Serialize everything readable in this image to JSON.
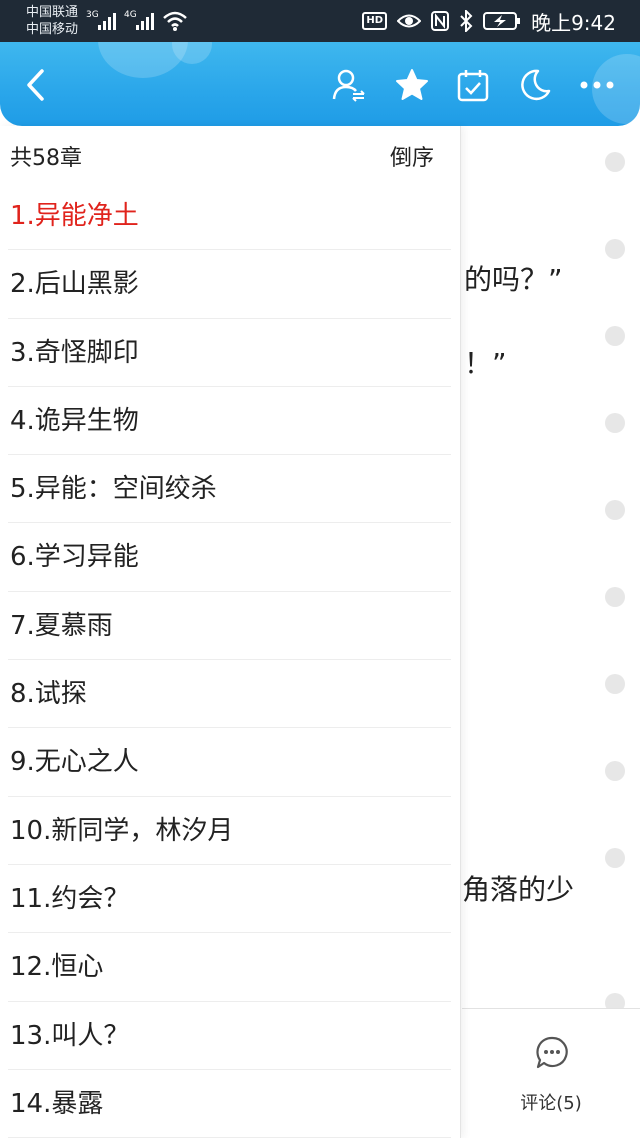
{
  "status_bar": {
    "carrier1": "中国联通",
    "carrier2": "中国移动",
    "net1": "3G",
    "net2": "4G",
    "hd": "HD",
    "time": "晚上9:42"
  },
  "header": {
    "icons": [
      "back-icon",
      "user-switch-icon",
      "star-icon",
      "calendar-check-icon",
      "moon-icon",
      "more-icon"
    ]
  },
  "drawer": {
    "count_label": "共58章",
    "reverse_label": "倒序",
    "active_color": "#e0231c",
    "chapters": [
      {
        "label": "1.异能净土",
        "active": true
      },
      {
        "label": "2.后山黑影"
      },
      {
        "label": "3.奇怪脚印"
      },
      {
        "label": "4.诡异生物"
      },
      {
        "label": "5.异能：空间绞杀"
      },
      {
        "label": "6.学习异能"
      },
      {
        "label": "7.夏慕雨"
      },
      {
        "label": "8.试探"
      },
      {
        "label": "9.无心之人"
      },
      {
        "label": "10.新同学，林汐月"
      },
      {
        "label": "11.约会？"
      },
      {
        "label": "12.恒心"
      },
      {
        "label": "13.叫人？"
      },
      {
        "label": "14.暴露"
      }
    ]
  },
  "reader": {
    "fragments": [
      "的吗？”",
      "！”",
      "角落的少"
    ]
  },
  "bottom_bar": {
    "comment_label": "评论(5)"
  },
  "colors": {
    "header_blue": "#2aa6ea",
    "status_bg": "#1f2a36"
  }
}
